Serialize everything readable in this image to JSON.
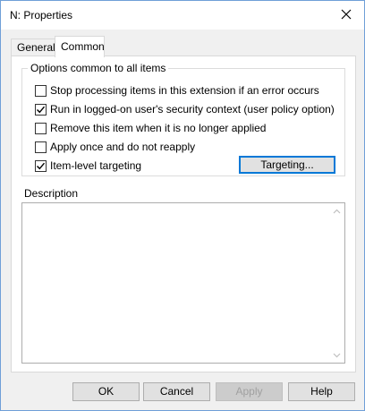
{
  "window": {
    "title": "N: Properties"
  },
  "tabs": [
    {
      "label": "General",
      "selected": false
    },
    {
      "label": "Common",
      "selected": true
    }
  ],
  "options_group": {
    "legend": "Options common to all items",
    "items": [
      {
        "label": "Stop processing items in this extension if an error occurs",
        "checked": false
      },
      {
        "label": "Run in logged-on user's security context (user policy option)",
        "checked": true
      },
      {
        "label": "Remove this item when it is no longer applied",
        "checked": false
      },
      {
        "label": "Apply once and do not reapply",
        "checked": false
      },
      {
        "label": "Item-level targeting",
        "checked": true
      }
    ],
    "targeting_button": "Targeting..."
  },
  "description": {
    "label": "Description",
    "value": ""
  },
  "buttons": {
    "ok": "OK",
    "cancel": "Cancel",
    "apply": "Apply",
    "help": "Help"
  },
  "colors": {
    "focus_border": "#0078d7",
    "window_border": "#6f9fd8"
  }
}
